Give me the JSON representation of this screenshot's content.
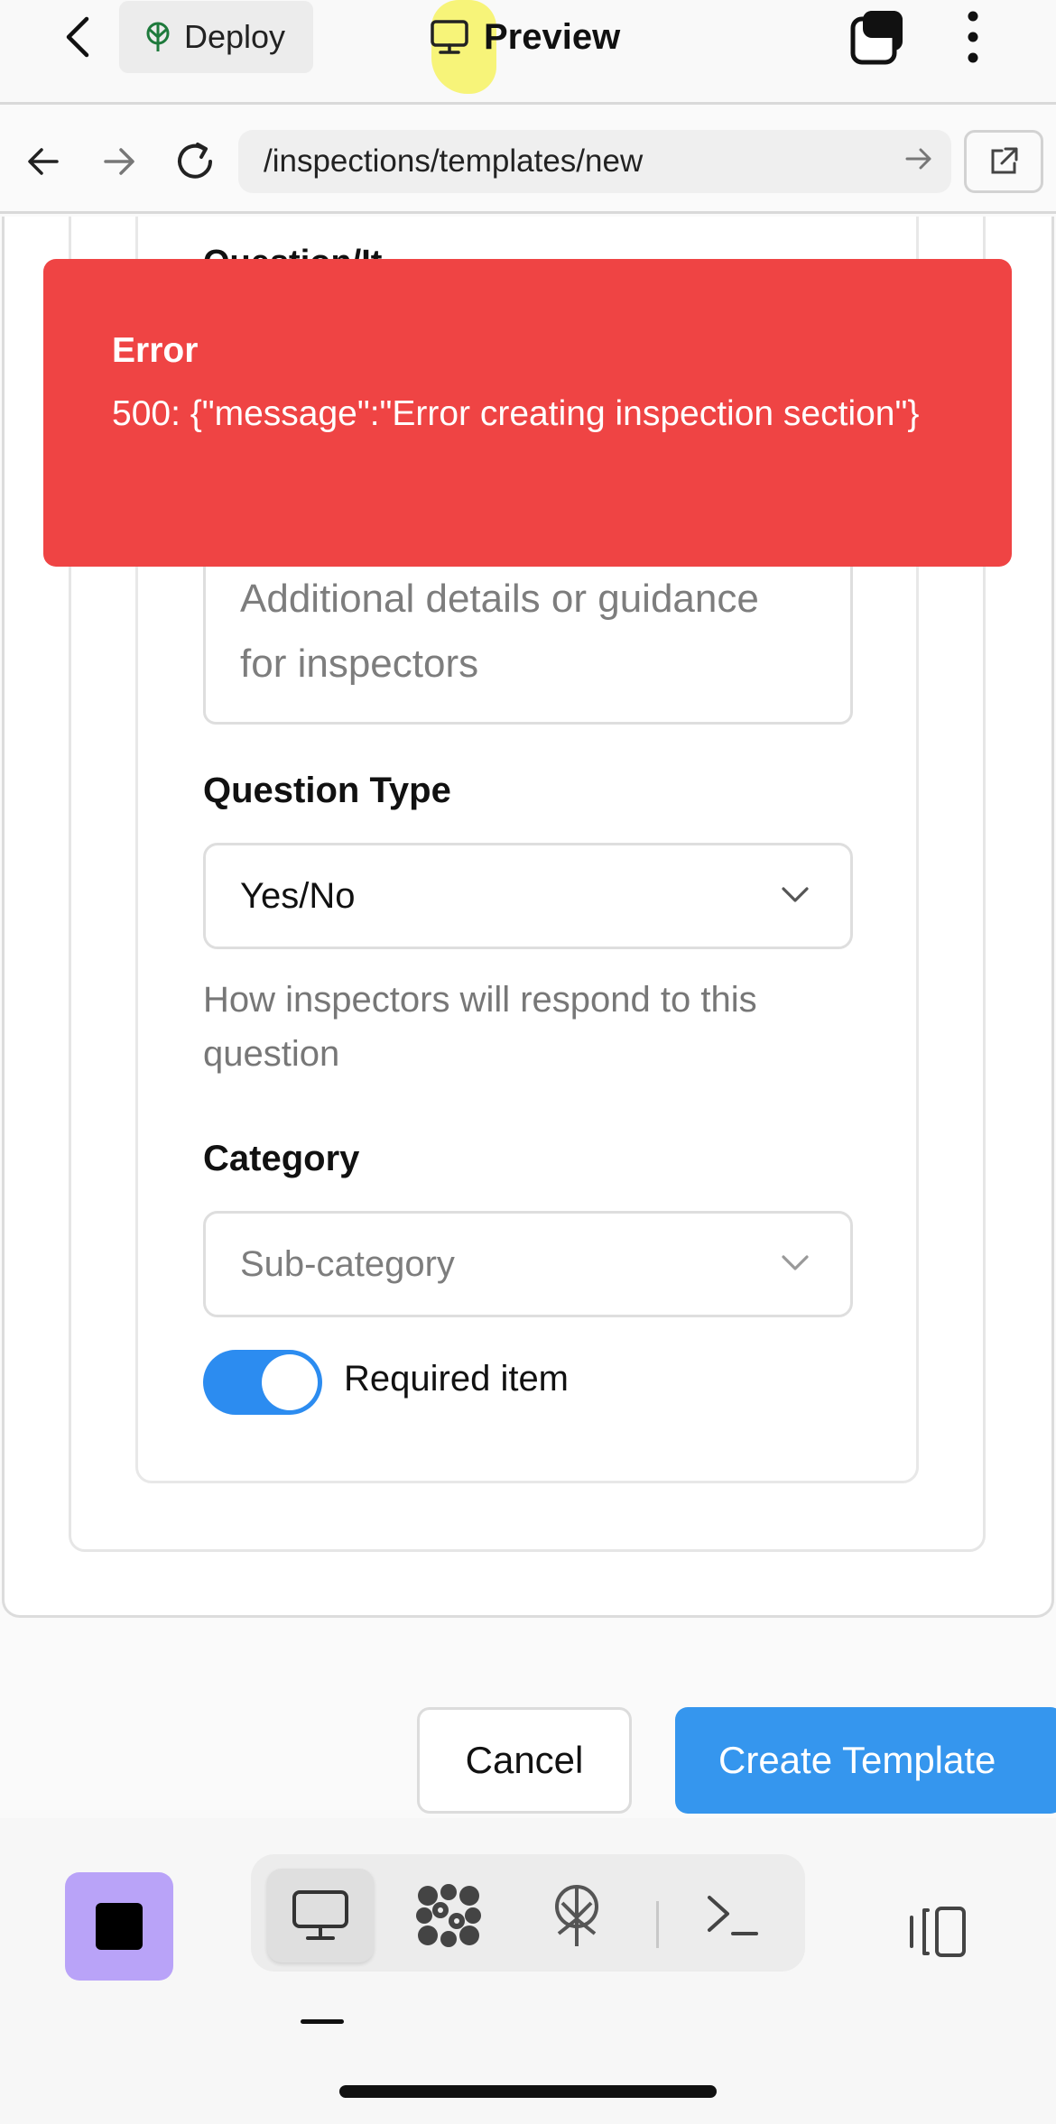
{
  "topbar": {
    "deploy_label": "Deploy",
    "preview_label": "Preview"
  },
  "browser": {
    "url": "/inspections/templates/new"
  },
  "form": {
    "clipped_label": "Question/It",
    "description_placeholder": "Additional details or guidance for inspectors",
    "question_type_label": "Question Type",
    "question_type_value": "Yes/No",
    "question_type_help": "How inspectors will respond to this question",
    "category_label": "Category",
    "category_placeholder": "Sub-category",
    "required_label": "Required item",
    "required_on": true
  },
  "actions": {
    "cancel_label": "Cancel",
    "create_label": "Create Template"
  },
  "toast": {
    "title": "Error",
    "message": "500: {\"message\":\"Error creating inspection section\"}"
  },
  "colors": {
    "toast_bg": "#ef4444",
    "primary": "#3596ee",
    "stop_button": "#b9a3f8"
  },
  "icons": {
    "topbar": [
      "chevron-left-icon",
      "deploy-icon",
      "monitor-icon",
      "tabs-icon",
      "more-vertical-icon"
    ],
    "browser": [
      "arrow-left-icon",
      "arrow-right-icon",
      "reload-icon",
      "arrow-right-icon",
      "external-link-icon"
    ],
    "toolbar": [
      "stop-icon",
      "monitor-icon",
      "dots-grid-icon",
      "deploy-icon",
      "terminal-icon",
      "layout-icon"
    ]
  }
}
